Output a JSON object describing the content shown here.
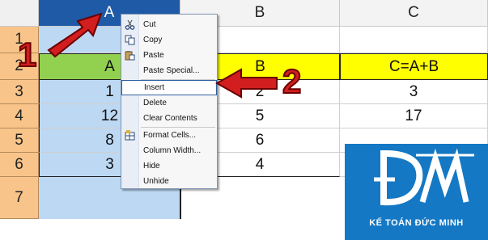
{
  "columns": {
    "a": "A",
    "b": "B",
    "c": "C"
  },
  "rows": [
    "1",
    "2",
    "3",
    "4",
    "5",
    "6",
    "7"
  ],
  "table": {
    "header": {
      "a": "A",
      "b": "B",
      "c": "C=A+B"
    },
    "data": [
      {
        "a": "1",
        "b": "2",
        "c": "3"
      },
      {
        "a": "12",
        "b": "5",
        "c": "17"
      },
      {
        "a": "8",
        "b": "6",
        "c": ""
      },
      {
        "a": "3",
        "b": "4",
        "c": ""
      }
    ]
  },
  "context_menu": {
    "items": [
      {
        "label": "Cut",
        "icon": "scissors-icon"
      },
      {
        "label": "Copy",
        "icon": "copy-icon"
      },
      {
        "label": "Paste",
        "icon": "paste-icon"
      },
      {
        "label": "Paste Special...",
        "icon": ""
      },
      {
        "label": "Insert",
        "icon": "",
        "highlighted": true
      },
      {
        "label": "Delete",
        "icon": ""
      },
      {
        "label": "Clear Contents",
        "icon": ""
      },
      {
        "label": "Format Cells...",
        "icon": "format-cells-icon"
      },
      {
        "label": "Column Width...",
        "icon": ""
      },
      {
        "label": "Hide",
        "icon": ""
      },
      {
        "label": "Unhide",
        "icon": ""
      }
    ]
  },
  "annotations": {
    "step1": "1",
    "step2": "2"
  },
  "logo": {
    "text": "KẾ TOÁN ĐỨC MINH",
    "mark": "ĐM"
  },
  "colors": {
    "header_yellow": "#ffff00",
    "header_green": "#92d050",
    "selection": "#bdd8f3",
    "row_header": "#f8c489",
    "logo_blue": "#1478c4",
    "arrow_red": "#d21e1e"
  }
}
